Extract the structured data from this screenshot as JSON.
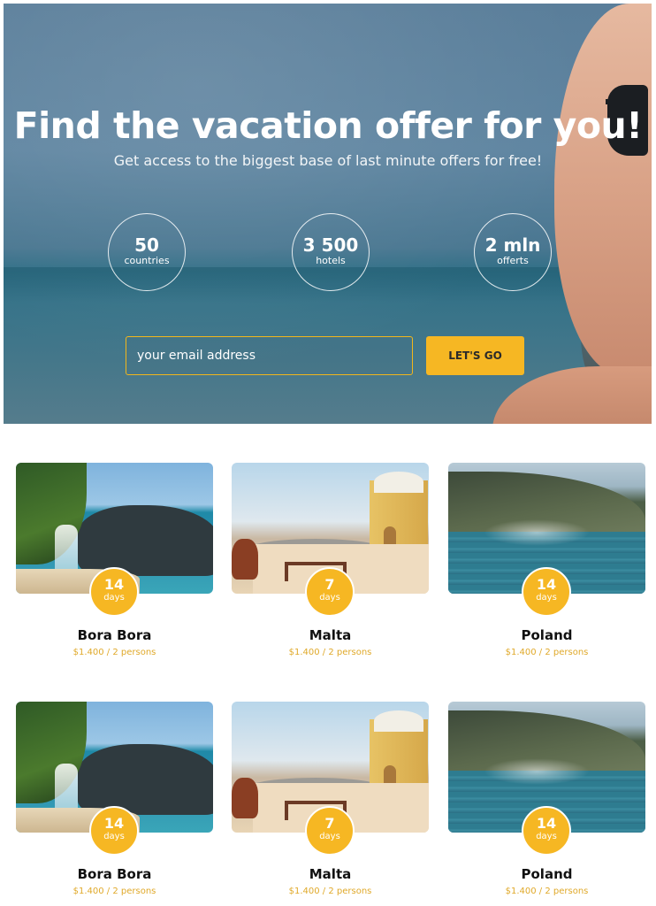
{
  "hero": {
    "headline": "Find the vacation offer for you!",
    "subline": "Get access to the biggest base of last minute offers for free!",
    "stats": [
      {
        "value": "50",
        "label": "countries"
      },
      {
        "value": "3 500",
        "label": "hotels"
      },
      {
        "value": "2 mln",
        "label": "offerts"
      }
    ],
    "email_placeholder": "your email address",
    "cta_label": "LET'S GO"
  },
  "colors": {
    "accent": "#f6b723",
    "price": "#e0a92a"
  },
  "offers": [
    {
      "title": "Bora Bora",
      "days": "14",
      "days_label": "days",
      "price": "$1.400 / 2 persons",
      "scene": "coast-waterfall"
    },
    {
      "title": "Malta",
      "days": "7",
      "days_label": "days",
      "price": "$1.400 / 2 persons",
      "scene": "tower-terrace"
    },
    {
      "title": "Poland",
      "days": "14",
      "days_label": "days",
      "price": "$1.400 / 2 persons",
      "scene": "lake-mountains"
    },
    {
      "title": "Bora Bora",
      "days": "14",
      "days_label": "days",
      "price": "$1.400 / 2 persons",
      "scene": "coast-waterfall"
    },
    {
      "title": "Malta",
      "days": "7",
      "days_label": "days",
      "price": "$1.400 / 2 persons",
      "scene": "tower-terrace"
    },
    {
      "title": "Poland",
      "days": "14",
      "days_label": "days",
      "price": "$1.400 / 2 persons",
      "scene": "lake-mountains"
    }
  ]
}
